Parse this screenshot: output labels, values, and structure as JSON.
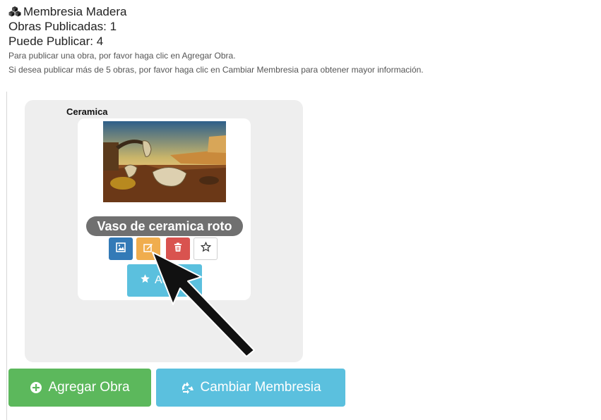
{
  "membership": {
    "name": "Membresia Madera",
    "published_line": "Obras Publicadas: 1",
    "can_publish_line": "Puede Publicar: 4",
    "info_1": "Para publicar una obra, por favor haga clic en Agregar Obra.",
    "info_2": "Si desea publicar más de 5 obras, por favor haga clic en Cambiar Membresia para obtener mayor información."
  },
  "category": {
    "title": "Ceramica",
    "work": {
      "caption": "Vaso de ceramica roto",
      "actions": [
        {
          "icon": "image-icon",
          "color": "#337ab7"
        },
        {
          "icon": "edit-icon",
          "color": "#f0ad4e"
        },
        {
          "icon": "trash-icon",
          "color": "#d9534f"
        },
        {
          "icon": "star-outline-icon",
          "color": "#ffffff"
        }
      ],
      "feature_button_label": "Ac"
    }
  },
  "footer": {
    "add_label": "Agregar Obra",
    "change_label": "Cambiar Membresia",
    "add_color": "#5cb85c",
    "change_color": "#5bc0de"
  }
}
